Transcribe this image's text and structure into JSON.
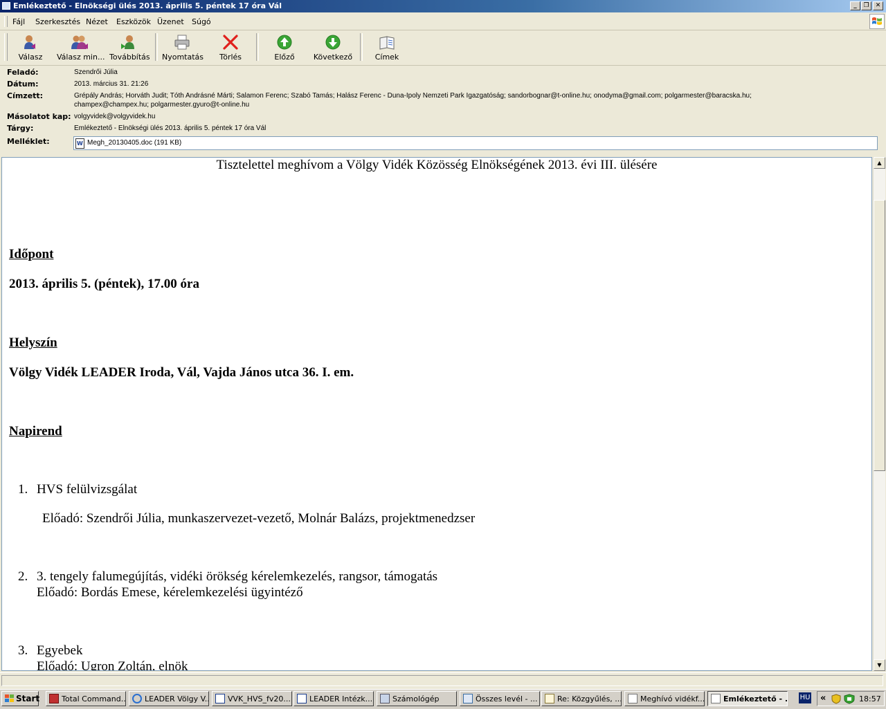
{
  "window": {
    "title": "Emlékeztető - Elnökségi ülés 2013. április 5. péntek 17 óra Vál",
    "minimize": "_",
    "restore": "❐",
    "close": "✕"
  },
  "menu": [
    "Fájl",
    "Szerkesztés",
    "Nézet",
    "Eszközök",
    "Üzenet",
    "Súgó"
  ],
  "toolbar": {
    "reply": "Válasz",
    "reply_all": "Válasz min...",
    "forward": "Továbbítás",
    "print": "Nyomtatás",
    "delete": "Törlés",
    "prev": "Előző",
    "next": "Következő",
    "addresses": "Címek"
  },
  "headers": {
    "from_label": "Feladó:",
    "from": "Szendrői Júlia",
    "date_label": "Dátum:",
    "date": "2013. március 31. 21:26",
    "to_label": "Címzett:",
    "to_line1": "Grépály András; Horváth Judit; Tóth Andrásné Márti; Salamon Ferenc; Szabó Tamás; Halász Ferenc - Duna-Ipoly Nemzeti Park Igazgatóság; sandorbognar@t-online.hu; onodyma@gmail.com; polgarmester@baracska.hu;",
    "to_line2": "champex@champex.hu; polgarmester.gyuro@t-online.hu",
    "cc_label": "Másolatot kap:",
    "cc": "volgyvidek@volgyvidek.hu",
    "subject_label": "Tárgy:",
    "subject": "Emlékeztető - Elnökségi ülés 2013. április 5. péntek 17 óra Vál",
    "attach_label": "Melléklet:",
    "attachment": "Megh_20130405.doc (191 KB)"
  },
  "body": {
    "intro": "Tisztelettel meghívom a Völgy Vidék Közösség Elnökségének 2013. évi III. ülésére",
    "time_heading": "Időpont",
    "time": "2013. április 5. (péntek), 17.00 óra",
    "place_heading": "Helyszín",
    "place": "Völgy Vidék LEADER Iroda, Vál, Vajda János utca 36. I. em.",
    "agenda_heading": "Napirend",
    "items": [
      {
        "num": "1.",
        "title": "HVS felülvizsgálat",
        "presenter": "Előadó: Szendrői Júlia, munkaszervezet-vezető, Molnár Balázs, projektmenedzser"
      },
      {
        "num": "2.",
        "title": "3. tengely falumegújítás, vidéki örökség kérelemkezelés, rangsor, támogatás",
        "presenter": "Előadó: Bordás Emese, kérelemkezelési ügyintéző"
      },
      {
        "num": "3.",
        "title": "Egyebek",
        "presenter": "Előadó: Ugron Zoltán, elnök"
      }
    ]
  },
  "scrollbar": {
    "position": 0.0,
    "up": "▲",
    "down": "▼"
  },
  "taskbar": {
    "start": "Start",
    "tasks": [
      "Total Command...",
      "LEADER Völgy V...",
      "VVK_HVS_fv20...",
      "LEADER Intézk...",
      "Számológép",
      "Összes levél - ...",
      "Re: Közgyűlés, ...",
      "Meghívó vidékf...",
      "Emlékeztető - ..."
    ],
    "language": "HU",
    "chevron": "«",
    "clock": "18:57"
  }
}
